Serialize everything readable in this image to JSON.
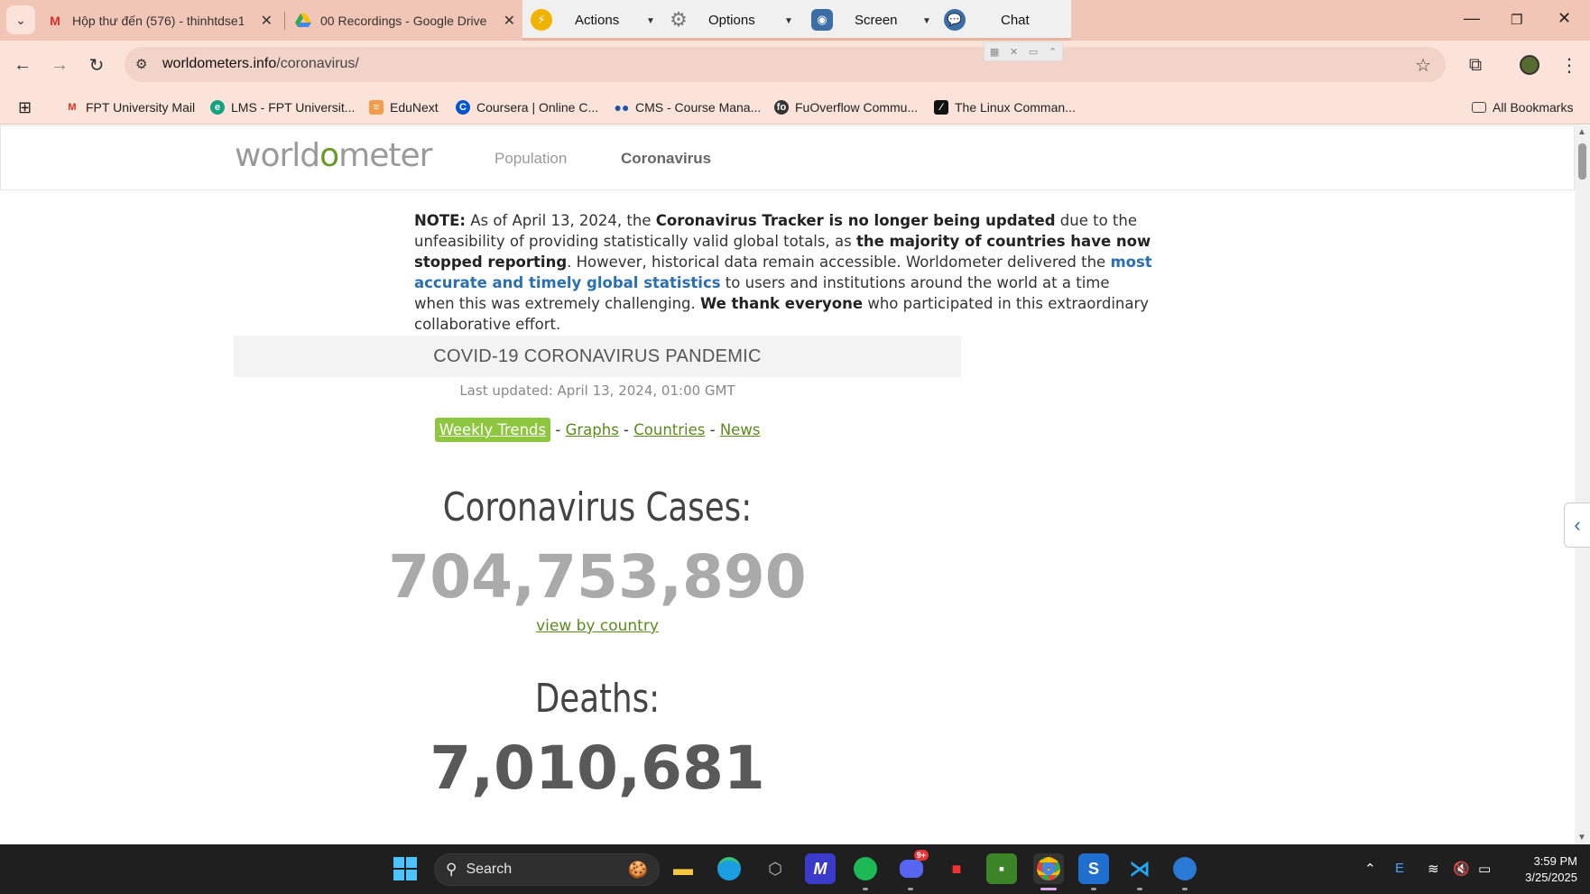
{
  "browser": {
    "tabs": [
      {
        "title": "Hộp thư đến (576) - thinhtdse1",
        "icon": "gmail-icon"
      },
      {
        "title": "00 Recordings - Google Drive",
        "icon": "google-drive-icon"
      }
    ],
    "extension_toolbar": {
      "actions_label": "Actions",
      "options_label": "Options",
      "screen_label": "Screen",
      "chat_label": "Chat"
    },
    "address": {
      "domain": "worldometers.info",
      "path": "/coronavirus/"
    },
    "bookmarks": [
      {
        "label": "FPT University Mail",
        "icon": "gmail-icon"
      },
      {
        "label": "LMS - FPT Universit...",
        "icon": "lms-icon"
      },
      {
        "label": "EduNext",
        "icon": "edunext-icon"
      },
      {
        "label": "Coursera | Online C...",
        "icon": "coursera-icon"
      },
      {
        "label": "CMS - Course Mana...",
        "icon": "cms-icon"
      },
      {
        "label": "FuOverflow Commu...",
        "icon": "fuoverflow-icon"
      },
      {
        "label": "The Linux Comman...",
        "icon": "linux-command-icon"
      }
    ],
    "all_bookmarks_label": "All Bookmarks"
  },
  "site": {
    "logo": {
      "pre": "world",
      "o": "o",
      "post": "meter"
    },
    "nav": {
      "population": "Population",
      "coronavirus": "Coronavirus"
    },
    "note": {
      "p1_bold": "NOTE:",
      "p1": " As of April 13, 2024, the ",
      "p2_bold": "Coronavirus Tracker is no longer being updated",
      "p3": " due to the unfeasibility of providing statistically valid global totals, as ",
      "p4_bold": "the majority of countries have now stopped reporting",
      "p5": ". However, historical data remain accessible. Worldometer delivered the ",
      "p6_link": "most accurate and timely global statistics",
      "p7": " to users and institutions around the world at a time when this was extremely challenging. ",
      "p8_bold": "We thank everyone",
      "p9": " who participated in this extraordinary collaborative effort."
    },
    "pandemic_title": "COVID-19 CORONAVIRUS PANDEMIC",
    "last_updated": "Last updated: April 13, 2024, 01:00 GMT",
    "links": {
      "weekly": "Weekly Trends",
      "graphs": "Graphs",
      "countries": "Countries",
      "news": "News",
      "sep": " - "
    },
    "cases_label": "Coronavirus Cases:",
    "cases_value": "704,753,890",
    "view_by_country": "view by country",
    "deaths_label": "Deaths:",
    "deaths_value": "7,010,681",
    "colors": {
      "accent_green": "#5b8a1d",
      "pill_green": "#8dc63f",
      "link_blue": "#2a6fb0"
    }
  },
  "taskbar": {
    "search_label": "Search",
    "clock_time": "3:59 PM",
    "clock_date": "3/25/2025",
    "discord_badge": "9+"
  }
}
